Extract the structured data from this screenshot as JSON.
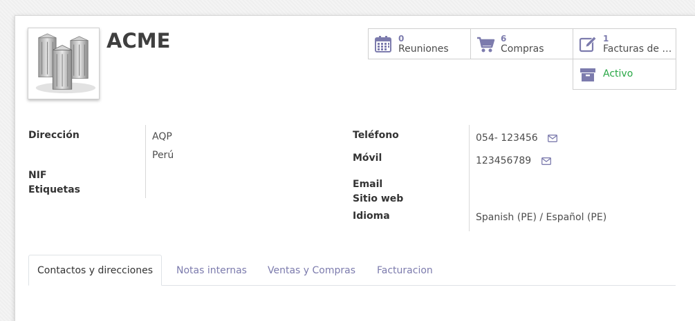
{
  "partner": {
    "name": "ACME"
  },
  "smart_buttons": {
    "meetings": {
      "count": "0",
      "label": "Reuniones"
    },
    "purchases": {
      "count": "6",
      "label": "Compras"
    },
    "invoices": {
      "count": "1",
      "label": "Facturas de …"
    },
    "active": {
      "label": "Activo"
    }
  },
  "fields": {
    "address_label": "Dirección",
    "address_line1": "AQP",
    "address_line2": "Perú",
    "vat_label": "NIF",
    "tags_label": "Etiquetas",
    "phone_label": "Teléfono",
    "phone_value": "054- 123456",
    "mobile_label": "Móvil",
    "mobile_value": "123456789",
    "email_label": "Email",
    "website_label": "Sitio web",
    "lang_label": "Idioma",
    "lang_value": "Spanish (PE) / Español (PE)"
  },
  "tabs": [
    {
      "label": "Contactos y direcciones",
      "active": true
    },
    {
      "label": "Notas internas",
      "active": false
    },
    {
      "label": "Ventas y Compras",
      "active": false
    },
    {
      "label": "Facturacion",
      "active": false
    }
  ],
  "colors": {
    "accent": "#7c7bad",
    "active_green": "#28a745"
  }
}
